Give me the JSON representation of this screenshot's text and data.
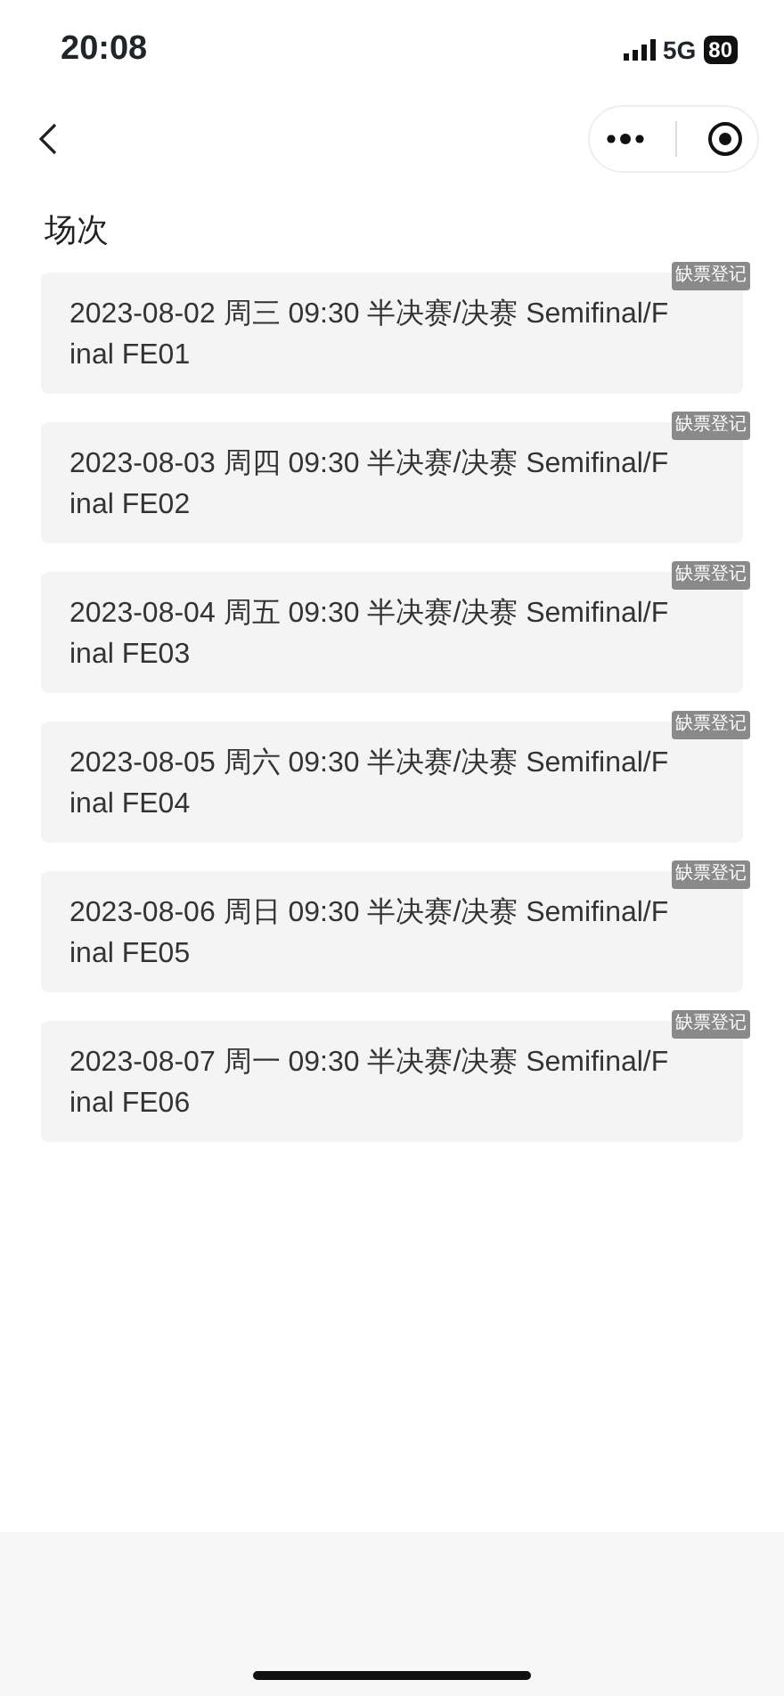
{
  "status_bar": {
    "time": "20:08",
    "network": "5G",
    "battery": "80"
  },
  "section_title": "场次",
  "sessions": [
    {
      "text": "2023-08-02 周三 09:30 半决赛/决赛 Semifinal/Final FE01",
      "tag": "缺票登记"
    },
    {
      "text": "2023-08-03 周四 09:30 半决赛/决赛 Semifinal/Final FE02",
      "tag": "缺票登记"
    },
    {
      "text": "2023-08-04 周五 09:30 半决赛/决赛 Semifinal/Final FE03",
      "tag": "缺票登记"
    },
    {
      "text": "2023-08-05 周六 09:30 半决赛/决赛 Semifinal/Final FE04",
      "tag": "缺票登记"
    },
    {
      "text": "2023-08-06 周日 09:30 半决赛/决赛 Semifinal/Final FE05",
      "tag": "缺票登记"
    },
    {
      "text": "2023-08-07 周一 09:30 半决赛/决赛 Semifinal/Final FE06",
      "tag": "缺票登记"
    }
  ]
}
